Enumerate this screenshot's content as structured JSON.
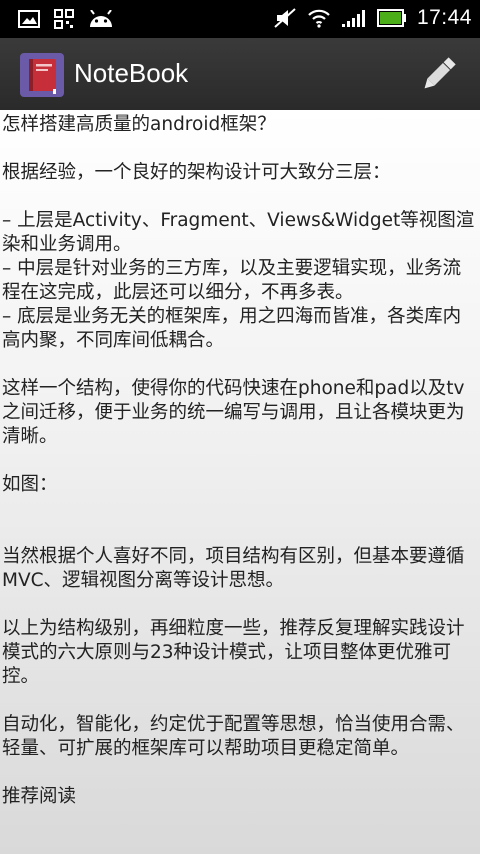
{
  "status_bar": {
    "icons_left": [
      "image-notification-icon",
      "qr-code-icon",
      "android-icon"
    ],
    "icons_right": [
      "mute-icon",
      "wifi-icon",
      "signal-icon",
      "battery-icon"
    ],
    "time": "17:44",
    "battery_color": "#4caf1a"
  },
  "action_bar": {
    "title": "NoteBook",
    "logo_icon": "notebook-icon",
    "edit_icon": "pencil-icon"
  },
  "note": {
    "body": "怎样搭建高质量的android框架？\n\n根据经验，一个良好的架构设计可大致分三层：\n\n– 上层是Activity、Fragment、Views&Widget等视图渲染和业务调用。\n– 中层是针对业务的三方库，以及主要逻辑实现，业务流程在这完成，此层还可以细分，不再多表。\n– 底层是业务无关的框架库，用之四海而皆准，各类库内高内聚，不同库间低耦合。\n\n这样一个结构，使得你的代码快速在phone和pad以及tv之间迁移，便于业务的统一编写与调用，且让各模块更为清晰。\n\n如图：\n\n\n当然根据个人喜好不同，项目结构有区别，但基本要遵循MVC、逻辑视图分离等设计思想。\n\n以上为结构级别，再细粒度一些，推荐反复理解实践设计模式的六大原则与23种设计模式，让项目整体更优雅可控。\n\n自动化，智能化，约定优于配置等思想，恰当使用合需、轻量、可扩展的框架库可以帮助项目更稳定简单。\n\n推荐阅读"
  }
}
